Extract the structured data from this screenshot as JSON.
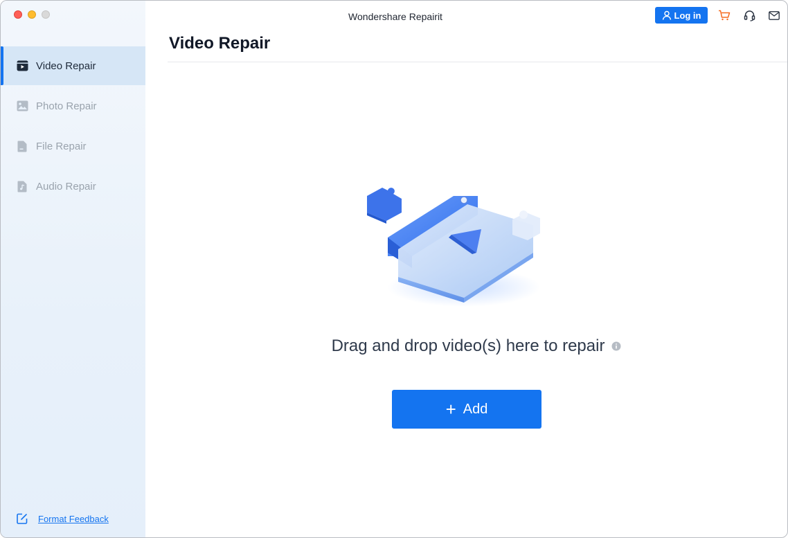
{
  "window": {
    "title": "Wondershare Repairit"
  },
  "header": {
    "login_label": "Log in",
    "icons": [
      "user-icon",
      "cart-icon",
      "headset-icon",
      "mail-icon"
    ],
    "cart_color": "#f56a1e"
  },
  "sidebar": {
    "items": [
      {
        "label": "Video Repair",
        "icon": "video-icon",
        "active": true
      },
      {
        "label": "Photo Repair",
        "icon": "photo-icon",
        "active": false
      },
      {
        "label": "File Repair",
        "icon": "file-icon",
        "active": false
      },
      {
        "label": "Audio Repair",
        "icon": "audio-icon",
        "active": false
      }
    ],
    "feedback_label": "Format Feedback"
  },
  "main": {
    "page_title": "Video Repair",
    "drop_text": "Drag and drop video(s) here to repair",
    "add_label": "Add"
  },
  "colors": {
    "accent": "#1474f0",
    "sidebar_active_bg": "#d6e6f6",
    "inactive_text": "#9aa3ad"
  }
}
